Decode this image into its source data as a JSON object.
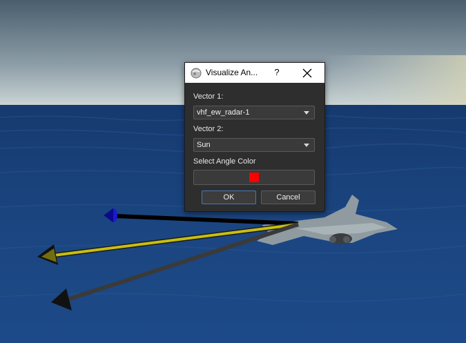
{
  "colors": {
    "sky_top": "#4a5d6e",
    "sky_horizon": "#c7d2d4",
    "sea_deep": "#163a6f",
    "sea_near": "#1e4a86",
    "vector_black": "#000000",
    "vector_yellow": "#c7bf12",
    "vector_gray": "#5a5a5a",
    "marker_blue": "#1a1ad0",
    "angle_color": "#ff0000"
  },
  "dialog": {
    "icon": "globe-icon",
    "title": "Visualize An...",
    "help_label": "?",
    "close_icon": "close-icon",
    "vector1_label": "Vector 1:",
    "vector1_value": "vhf_ew_radar-1",
    "vector2_label": "Vector 2:",
    "vector2_value": "Sun",
    "angle_color_label": "Select Angle Color",
    "ok_label": "OK",
    "cancel_label": "Cancel"
  }
}
